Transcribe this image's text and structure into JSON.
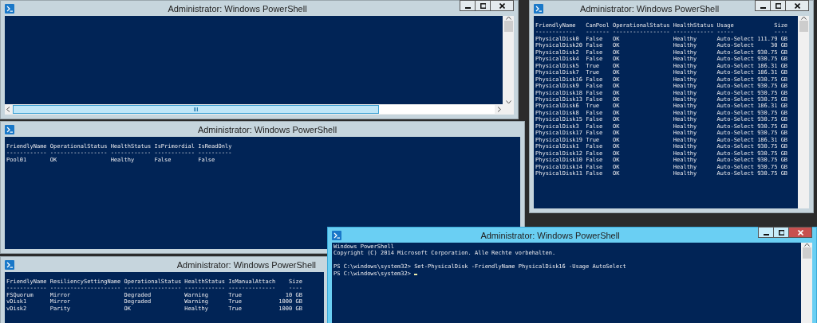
{
  "windows": [
    {
      "title": "Administrator: Windows PowerShell",
      "active": false,
      "horizontal_scrollbar": true
    },
    {
      "title": "Administrator: Windows PowerShell",
      "active": false,
      "horizontal_scrollbar": false,
      "lines": [
        "FriendlyName OperationalStatus HealthStatus IsPrimordial IsReadOnly",
        "------------ ----------------- ------------ ------------ ----------",
        "Pool01       OK                Healthy      False        False"
      ]
    },
    {
      "title": "Administrator: Windows PowerShell",
      "active": false,
      "horizontal_scrollbar": false,
      "lines": [
        "FriendlyName   CanPool OperationalStatus HealthStatus Usage            Size",
        "------------   ------- ----------------- ------------ -----            ----",
        "PhysicalDisk0  False   OK                Healthy      Auto-Select 111.79 GB",
        "PhysicalDisk20 False   OK                Healthy      Auto-Select     30 GB",
        "PhysicalDisk2  False   OK                Healthy      Auto-Select 930.75 GB",
        "PhysicalDisk4  False   OK                Healthy      Auto-Select 930.75 GB",
        "PhysicalDisk5  True    OK                Healthy      Auto-Select 186.31 GB",
        "PhysicalDisk7  True    OK                Healthy      Auto-Select 186.31 GB",
        "PhysicalDisk16 False   OK                Healthy      Auto-Select 930.75 GB",
        "PhysicalDisk9  False   OK                Healthy      Auto-Select 930.75 GB",
        "PhysicalDisk18 False   OK                Healthy      Auto-Select 930.75 GB",
        "PhysicalDisk13 False   OK                Healthy      Auto-Select 930.75 GB",
        "PhysicalDisk6  True    OK                Healthy      Auto-Select 186.31 GB",
        "PhysicalDisk8  False   OK                Healthy      Auto-Select 930.75 GB",
        "PhysicalDisk15 False   OK                Healthy      Auto-Select 930.75 GB",
        "PhysicalDisk3  False   OK                Healthy      Auto-Select 930.75 GB",
        "PhysicalDisk17 False   OK                Healthy      Auto-Select 930.75 GB",
        "PhysicalDisk19 True    OK                Healthy      Auto-Select 186.31 GB",
        "PhysicalDisk1  False   OK                Healthy      Auto-Select 930.75 GB",
        "PhysicalDisk12 False   OK                Healthy      Auto-Select 930.75 GB",
        "PhysicalDisk10 False   OK                Healthy      Auto-Select 930.75 GB",
        "PhysicalDisk14 False   OK                Healthy      Auto-Select 930.75 GB",
        "PhysicalDisk11 False   OK                Healthy      Auto-Select 930.75 GB"
      ]
    },
    {
      "title": "Administrator: Windows PowerShell",
      "active": false,
      "horizontal_scrollbar": false,
      "lines": [
        "FriendlyName ResiliencySettingName OperationalStatus HealthStatus IsManualAttach    Size",
        "------------ --------------------- ----------------- ------------ --------------    ----",
        "FSQuorum     Mirror                Degraded          Warning      True             10 GB",
        "vDisk1       Mirror                Degraded          Warning      True           1000 GB",
        "vDisk2       Parity                OK                Healthy      True           1000 GB"
      ]
    },
    {
      "title": "Administrator: Windows PowerShell",
      "active": true,
      "horizontal_scrollbar": false,
      "lines": [
        {
          "text": "Windows PowerShell",
          "blank_before": false,
          "cursor": false
        },
        {
          "text": "Copyright (C) 2014 Microsoft Corporation. Alle Rechte vorbehalten.",
          "blank_before": false,
          "cursor": false
        },
        {
          "text": "PS C:\\windows\\system32> Set-PhysicalDisk -FriendlyName PhysicalDisk16 -Usage AutoSelect",
          "blank_before": true,
          "cursor": false
        },
        {
          "text": "PS C:\\windows\\system32>",
          "blank_before": false,
          "cursor": true
        }
      ]
    }
  ]
}
